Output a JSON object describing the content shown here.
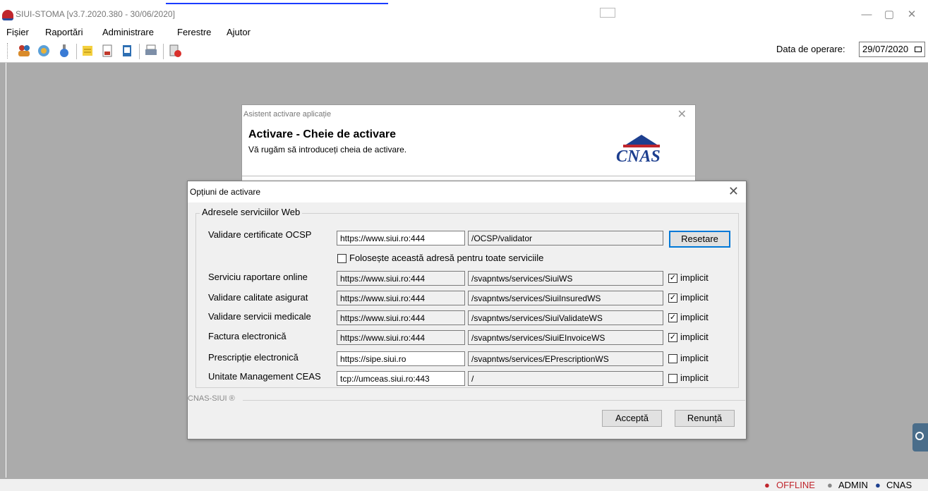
{
  "app": {
    "title": "SIUI-STOMA [v3.7.2020.380 - 30/06/2020]",
    "window_controls": {
      "minimize": "—",
      "maximize": "▢",
      "close": "✕"
    }
  },
  "menu": [
    "Fișier",
    "Raportări",
    "Administrare",
    "Ferestre",
    "Ajutor"
  ],
  "toolbar": {
    "icons": [
      "users-icon",
      "globe-icon",
      "flask-icon",
      "notes-icon",
      "document-icon",
      "report-icon",
      "printer-icon",
      "exit-icon"
    ],
    "date_label": "Data de operare:",
    "date_value": "29/07/2020"
  },
  "wizard": {
    "title": "Asistent activare aplicație",
    "heading": "Activare - Cheie de activare",
    "subtitle": "Vă rugăm să introduceți cheia de activare.",
    "logo_text": "CNAS"
  },
  "options": {
    "title": "Opțiuni de activare",
    "group_label": "Adresele serviciilor Web",
    "ocsp": {
      "label": "Validare certificate OCSP",
      "host": "https://www.siui.ro:444",
      "path": "/OCSP/validator",
      "reset_label": "Resetare"
    },
    "use_for_all_label": "Folosește această adresă pentru toate serviciile",
    "use_for_all_checked": false,
    "services": [
      {
        "label": "Serviciu raportare online",
        "host": "https://www.siui.ro:444",
        "path": "/svapntws/services/SiuiWS",
        "implicit": true
      },
      {
        "label": "Validare calitate asigurat",
        "host": "https://www.siui.ro:444",
        "path": "/svapntws/services/SiuiInsuredWS",
        "implicit": true
      },
      {
        "label": "Validare servicii medicale",
        "host": "https://www.siui.ro:444",
        "path": "/svapntws/services/SiuiValidateWS",
        "implicit": true
      },
      {
        "label": "Factura electronică",
        "host": "https://www.siui.ro:444",
        "path": "/svapntws/services/SiuiEInvoiceWS",
        "implicit": true
      },
      {
        "label": "Prescripție electronică",
        "host": "https://sipe.siui.ro",
        "path": "/svapntws/services/EPrescriptionWS",
        "implicit": false
      },
      {
        "label": "Unitate Management CEAS",
        "host": "tcp://umceas.siui.ro:443",
        "path": "/",
        "implicit": false
      }
    ],
    "implicit_label": "implicit",
    "footer_brand": "CNAS-SIUI ®",
    "accept_label": "Acceptă",
    "cancel_label": "Renunță"
  },
  "status": {
    "offline": "OFFLINE",
    "user": "ADMIN",
    "org": "CNAS"
  },
  "colors": {
    "offline": "#c0262d",
    "cnas_blue": "#1d3f8f",
    "focus": "#0078d7"
  }
}
